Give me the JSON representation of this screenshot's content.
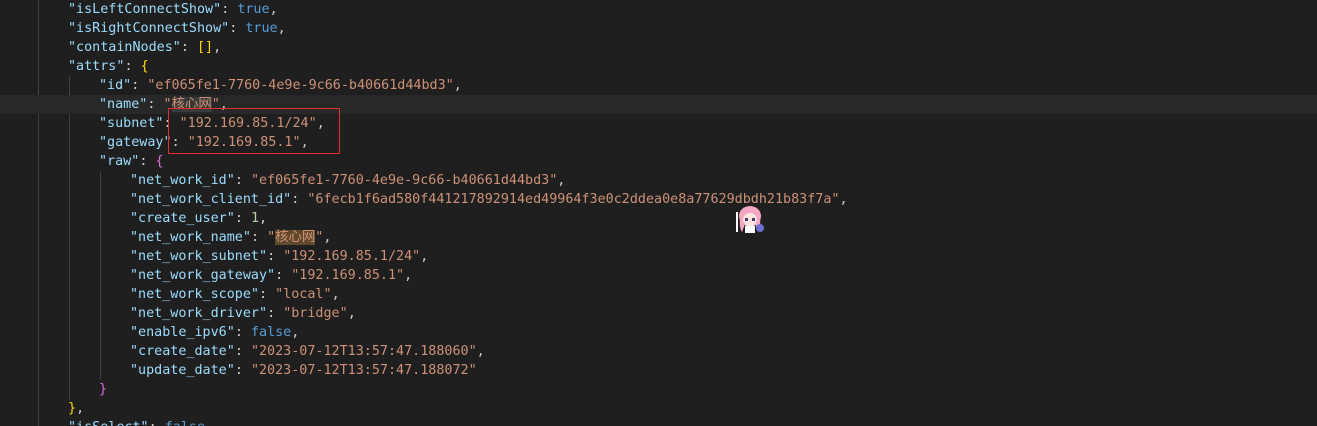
{
  "lines": [
    {
      "indent": 2,
      "key": "\"isLeftConnectShow\"",
      "sep": ": ",
      "vtype": "b",
      "val": "true",
      "tail": ","
    },
    {
      "indent": 2,
      "key": "\"isRightConnectShow\"",
      "sep": ": ",
      "vtype": "b",
      "val": "true",
      "tail": ","
    },
    {
      "indent": 2,
      "key": "\"containNodes\"",
      "sep": ": ",
      "vtype": "br",
      "val": "[]",
      "tail": ","
    },
    {
      "indent": 2,
      "key": "\"attrs\"",
      "sep": ": ",
      "vtype": "br",
      "val": "{",
      "tail": ""
    },
    {
      "indent": 3,
      "key": "\"id\"",
      "sep": ": ",
      "vtype": "s",
      "val": "\"ef065fe1-7760-4e9e-9c66-b40661d44bd3\"",
      "tail": ","
    },
    {
      "indent": 3,
      "key": "\"name\"",
      "sep": ": ",
      "vtype": "sh",
      "val": "\"核心网\"",
      "tail": ","
    },
    {
      "indent": 3,
      "key": "\"subnet\"",
      "sep": ": ",
      "vtype": "s",
      "val": "\"192.169.85.1/24\"",
      "tail": ","
    },
    {
      "indent": 3,
      "key": "\"gateway\"",
      "sep": ": ",
      "vtype": "s",
      "val": "\"192.169.85.1\"",
      "tail": ","
    },
    {
      "indent": 3,
      "key": "\"raw\"",
      "sep": ": ",
      "vtype": "br",
      "val": "{",
      "tail": ""
    },
    {
      "indent": 4,
      "key": "\"net_work_id\"",
      "sep": ": ",
      "vtype": "s",
      "val": "\"ef065fe1-7760-4e9e-9c66-b40661d44bd3\"",
      "tail": ","
    },
    {
      "indent": 4,
      "key": "\"net_work_client_id\"",
      "sep": ": ",
      "vtype": "s",
      "val": "\"6fecb1f6ad580f441217892914ed49964f3e0c2ddea0e8a77629dbdh21b83f7a\"",
      "tail": ","
    },
    {
      "indent": 4,
      "key": "\"create_user\"",
      "sep": ": ",
      "vtype": "n",
      "val": "1",
      "tail": ","
    },
    {
      "indent": 4,
      "key": "\"net_work_name\"",
      "sep": ": ",
      "vtype": "sh",
      "val": "\"核心网\"",
      "tail": ","
    },
    {
      "indent": 4,
      "key": "\"net_work_subnet\"",
      "sep": ": ",
      "vtype": "s",
      "val": "\"192.169.85.1/24\"",
      "tail": ","
    },
    {
      "indent": 4,
      "key": "\"net_work_gateway\"",
      "sep": ": ",
      "vtype": "s",
      "val": "\"192.169.85.1\"",
      "tail": ","
    },
    {
      "indent": 4,
      "key": "\"net_work_scope\"",
      "sep": ": ",
      "vtype": "s",
      "val": "\"local\"",
      "tail": ","
    },
    {
      "indent": 4,
      "key": "\"net_work_driver\"",
      "sep": ": ",
      "vtype": "s",
      "val": "\"bridge\"",
      "tail": ","
    },
    {
      "indent": 4,
      "key": "\"enable_ipv6\"",
      "sep": ": ",
      "vtype": "b",
      "val": "false",
      "tail": ","
    },
    {
      "indent": 4,
      "key": "\"create_date\"",
      "sep": ": ",
      "vtype": "s",
      "val": "\"2023-07-12T13:57:47.188060\"",
      "tail": ","
    },
    {
      "indent": 4,
      "key": "\"update_date\"",
      "sep": ": ",
      "vtype": "s",
      "val": "\"2023-07-12T13:57:47.188072\"",
      "tail": ""
    },
    {
      "indent": 3,
      "key": "",
      "sep": "",
      "vtype": "br",
      "val": "}",
      "tail": ""
    },
    {
      "indent": 2,
      "key": "",
      "sep": "",
      "vtype": "br",
      "val": "}",
      "tail": ","
    },
    {
      "indent": 2,
      "key": "\"isSelect\"",
      "sep": ": ",
      "vtype": "b",
      "val": "false",
      "tail": ""
    }
  ],
  "current_line_index": 5,
  "colors": {
    "background": "#1f1f1f",
    "key": "#9cdcfe",
    "string": "#ce9178",
    "boolean": "#569cd6",
    "number": "#b5cea8",
    "highlight_box": "#e0302c"
  },
  "decor": {
    "sticker_icon": "anime-girl-sticker-icon"
  }
}
